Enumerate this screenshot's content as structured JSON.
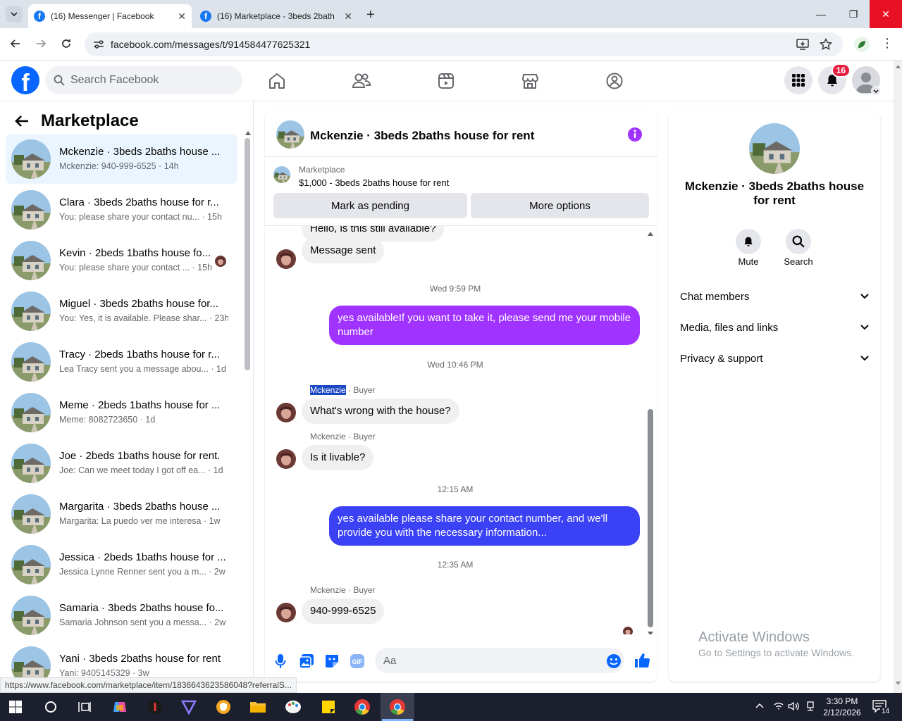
{
  "browser": {
    "tabs": [
      {
        "title": "(16) Messenger | Facebook",
        "active": true
      },
      {
        "title": "(16) Marketplace - 3beds 2bath",
        "active": false
      }
    ],
    "url": "facebook.com/messages/t/914584477625321",
    "status_url": "https://www.facebook.com/marketplace/item/1836643623586048?referralS..."
  },
  "header": {
    "search_placeholder": "Search Facebook",
    "notif_count": "16"
  },
  "sidebar": {
    "title": "Marketplace",
    "conversations": [
      {
        "name": "Mckenzie · 3beds 2baths house ...",
        "preview": "Mckenzie: 940-999-6525 · 14h",
        "selected": true
      },
      {
        "name": "Clara · 3beds 2baths house for r...",
        "preview": "You: please share your contact nu... · 15h"
      },
      {
        "name": "Kevin · 2beds 1baths house fo...",
        "preview": "You: please share your contact ... · 15h"
      },
      {
        "name": "Miguel · 3beds 2baths house for...",
        "preview": "You: Yes, it is available. Please shar... · 23h"
      },
      {
        "name": "Tracy · 2beds 1baths house for r...",
        "preview": "Lea Tracy sent you a message abou... · 1d"
      },
      {
        "name": "Meme · 2beds 1baths house for ...",
        "preview": "Meme: 8082723650 · 1d"
      },
      {
        "name": "Joe · 2beds 1baths house for rent.",
        "preview": "Joe: Can we meet today I got off ea... · 1d"
      },
      {
        "name": "Margarita · 3beds 2baths house ...",
        "preview": "Margarita: La puedo ver me interesa · 1w"
      },
      {
        "name": "Jessica · 2beds 1baths house for ...",
        "preview": "Jessica Lynne Renner sent you a m... · 2w"
      },
      {
        "name": "Samaria · 3beds 2baths house fo...",
        "preview": "Samaria Johnson sent you a messa... · 2w"
      },
      {
        "name": "Yani · 3beds 2baths house for rent",
        "preview": "Yani: 9405145329 · 3w"
      }
    ]
  },
  "chat": {
    "title": "Mckenzie · 3beds 2baths house for rent",
    "marketplace_label": "Marketplace",
    "listing": "$1,000 - 3beds 2baths house for rent",
    "btn_pending": "Mark as pending",
    "btn_more": "More options",
    "partial_msg": "Hello, is this still available?",
    "msg_sent": "Message sent",
    "ts1": "Wed 9:59 PM",
    "out1": "yes availableIf you want to take it, please send me your mobile number",
    "ts2": "Wed 10:46 PM",
    "sender_name": "Mckenzie",
    "sender_role": " · Buyer",
    "sender_full": "Mckenzie · Buyer",
    "in1": "What's wrong with the house?",
    "in2": "Is it livable?",
    "ts3": "12:15 AM",
    "out2": "yes available  please share your contact number, and we'll provide you with the necessary information...",
    "ts4": "12:35 AM",
    "in3": "940-999-6525",
    "composer_placeholder": "Aa",
    "colors": {
      "out1": "#a033ff",
      "out2": "#3b41f5",
      "accent": "#0866ff"
    }
  },
  "details": {
    "title": "Mckenzie · 3beds 2baths house for rent",
    "mute": "Mute",
    "search": "Search",
    "sections": [
      "Chat members",
      "Media, files and links",
      "Privacy & support"
    ]
  },
  "watermark": {
    "line1": "Activate Windows",
    "line2": "Go to Settings to activate Windows."
  },
  "taskbar": {
    "time": "3:30 PM",
    "date": "2/12/2026",
    "notif": "14"
  }
}
